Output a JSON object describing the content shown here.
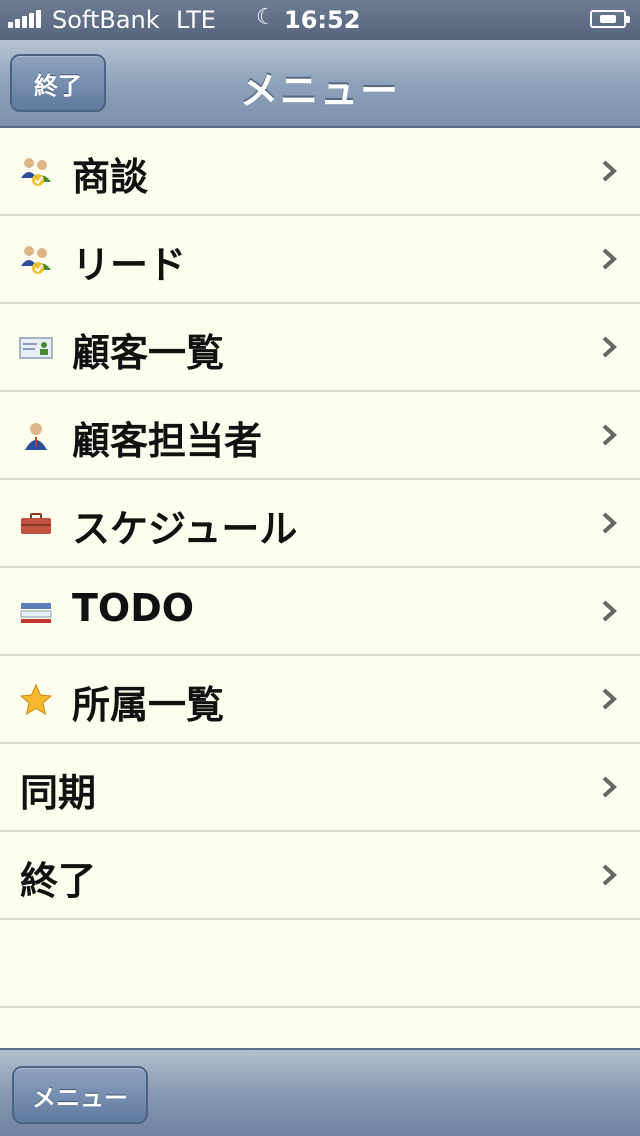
{
  "status_bar": {
    "carrier": "SoftBank",
    "network": "LTE",
    "time": "16:52",
    "icons": [
      "signal-icon",
      "moon-icon",
      "battery-icon"
    ]
  },
  "nav_bar": {
    "title": "メニュー",
    "back_button_label": "終了"
  },
  "menu": {
    "items": [
      {
        "label": "商談",
        "icon": "people-icon"
      },
      {
        "label": "リード",
        "icon": "people-icon"
      },
      {
        "label": "顧客一覧",
        "icon": "business-card-icon"
      },
      {
        "label": "顧客担当者",
        "icon": "person-icon"
      },
      {
        "label": "スケジュール",
        "icon": "briefcase-icon"
      },
      {
        "label": "TODO",
        "icon": "list-icon"
      },
      {
        "label": "所属一覧",
        "icon": "star-icon"
      },
      {
        "label": "同期",
        "icon": ""
      },
      {
        "label": "終了",
        "icon": ""
      }
    ]
  },
  "toolbar": {
    "button_label": "メニュー"
  },
  "colors": {
    "list_background": "#fdfdee",
    "nav_bar": "#8fa2bb",
    "separator": "#dcdcd0"
  }
}
